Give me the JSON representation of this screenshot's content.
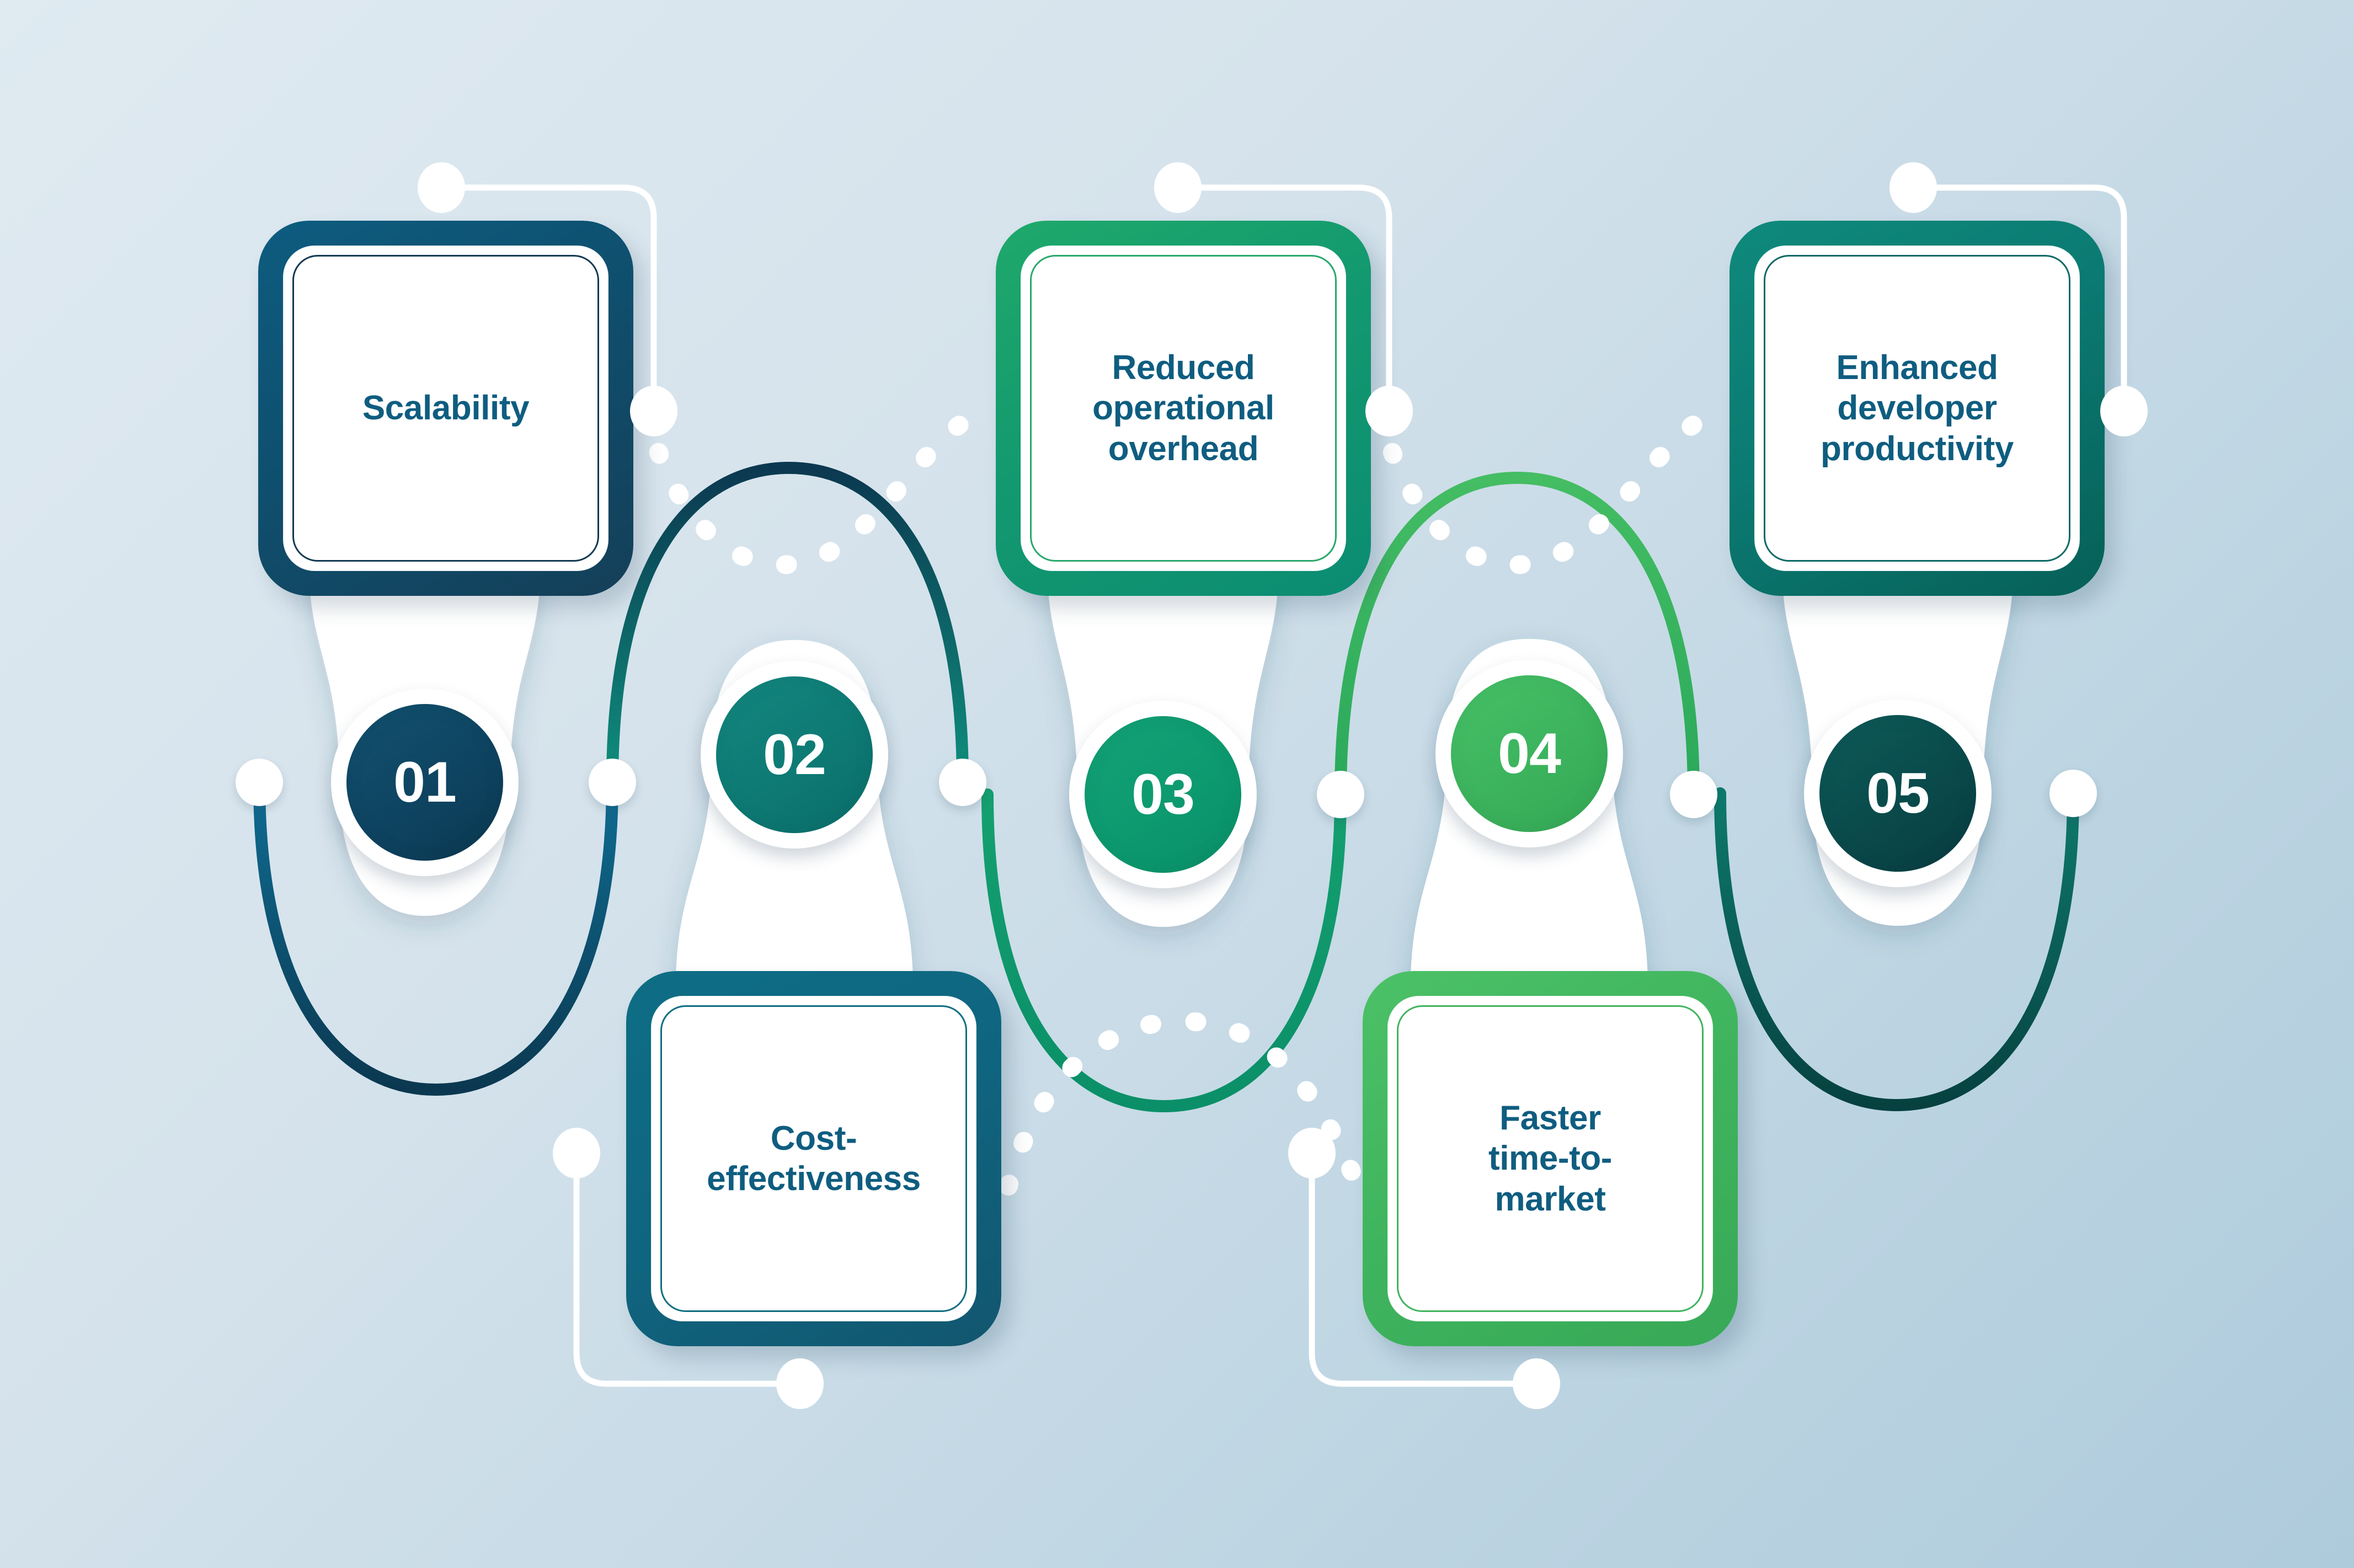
{
  "infographic": {
    "title_hidden": "",
    "background": {
      "gradient_from": "#dfeaf1",
      "gradient_to": "#aecbdc"
    },
    "steps": [
      {
        "number": "01",
        "label": "Scalability",
        "card_color": "#0f4f6e",
        "circle_color": "#0e4461",
        "position": "top"
      },
      {
        "number": "02",
        "label": "Cost-effectiveness",
        "card_color": "#0f6580",
        "circle_color": "#0e7a74",
        "position": "bottom"
      },
      {
        "number": "03",
        "label": "Reduced operational overhead",
        "card_color": "#13996f",
        "circle_color": "#0d9a6f",
        "position": "top"
      },
      {
        "number": "04",
        "label": "Faster time-to-market",
        "card_color": "#3fb45e",
        "circle_color": "#3cb35d",
        "position": "bottom"
      },
      {
        "number": "05",
        "label": "Enhanced developer productivity",
        "card_color": "#0b7a72",
        "circle_color": "#0a4a4b",
        "position": "top"
      }
    ],
    "card_lines": {
      "c1": [
        "Scalability"
      ],
      "c2": [
        "Cost-",
        "effectiveness"
      ],
      "c3": [
        "Reduced",
        "operational",
        "overhead"
      ],
      "c4": [
        "Faster",
        "time-to-",
        "market"
      ],
      "c5": [
        "Enhanced",
        "developer",
        "productivity"
      ]
    },
    "accent_colors": {
      "navy": "#0e4461",
      "teal": "#0e7a74",
      "green_dark": "#0d9a6f",
      "green_light": "#3cb35d",
      "teal_dark": "#0a4a4b",
      "text_blue": "#0f5d80",
      "white": "#ffffff"
    }
  }
}
